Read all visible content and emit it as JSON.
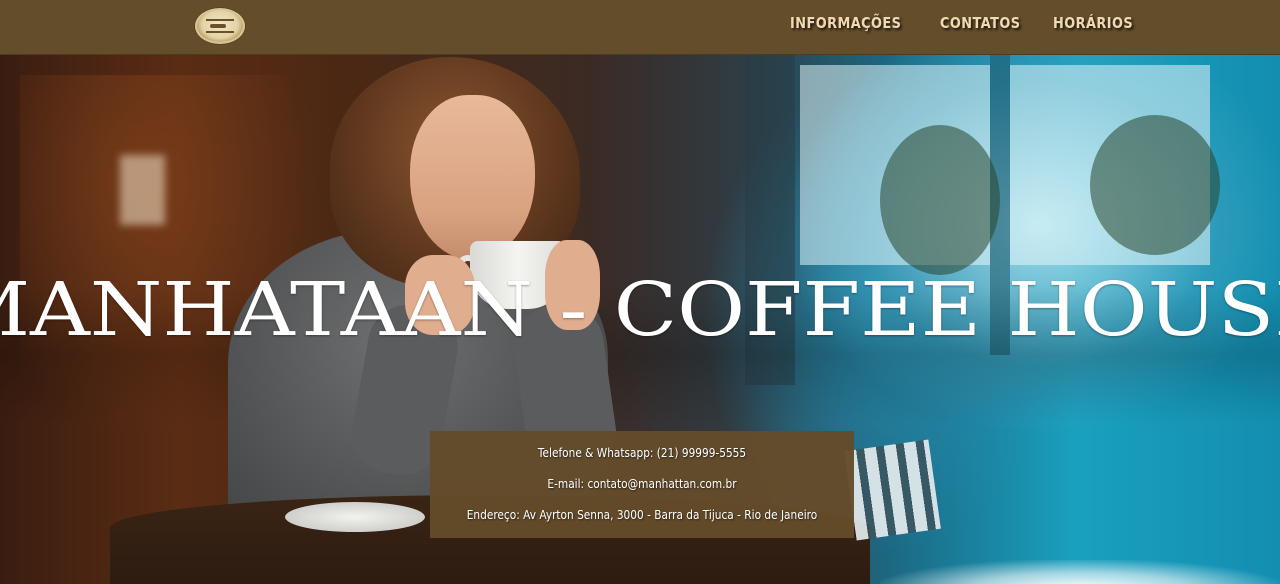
{
  "header": {
    "logo_icon": "coffee-house-logo",
    "nav": [
      {
        "label": "INFORMAÇÕES"
      },
      {
        "label": "CONTATOS"
      },
      {
        "label": "HORÁRIOS"
      }
    ]
  },
  "hero": {
    "title": "MANHATAAN - COFFEE HOUSE",
    "image": "woman-sipping-coffee-photo"
  },
  "contact": {
    "phone": "Telefone & Whatsapp: (21) 99999-5555",
    "email": "E-mail: contato@manhattan.com.br",
    "address": "Endereço: Av Ayrton Senna, 3000 - Barra da Tijuca - Rio de Janeiro"
  },
  "colors": {
    "nav_background": "#644d2b",
    "nav_text": "#f0d9b3",
    "contact_background": "#644c2b",
    "title_text": "#ffffff"
  }
}
